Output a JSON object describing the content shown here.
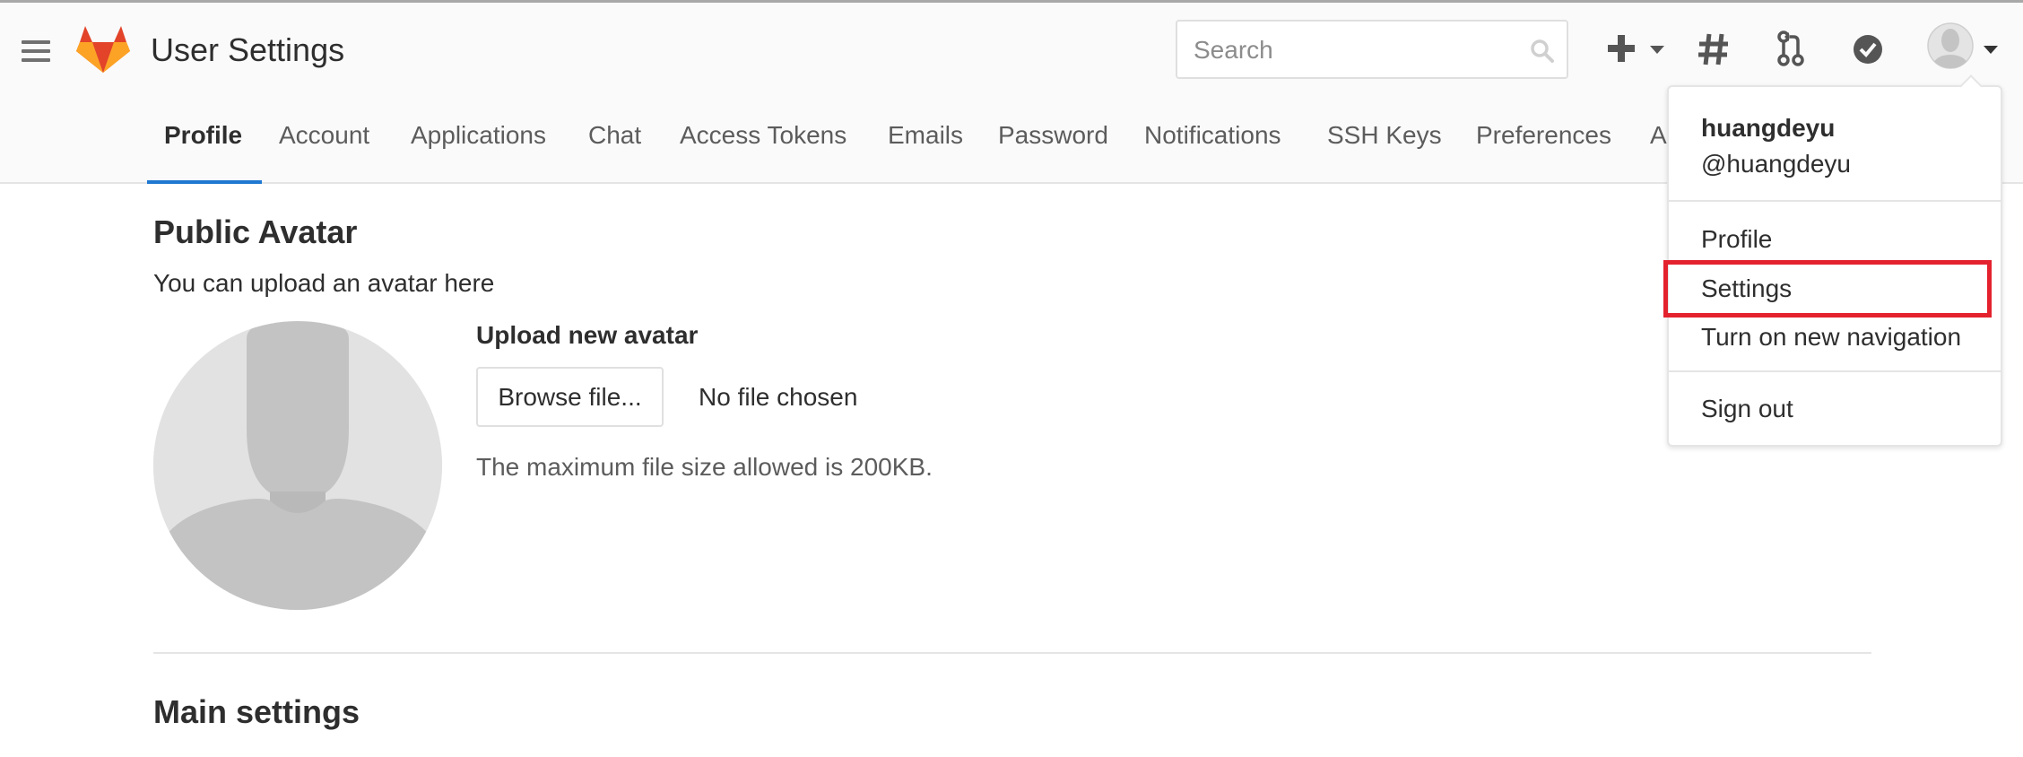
{
  "header": {
    "title": "User Settings",
    "search": {
      "placeholder": "Search",
      "value": ""
    },
    "icons": [
      "menu-icon",
      "gitlab-logo",
      "plus-icon",
      "hash-icon",
      "merge-request-icon",
      "todo-check-icon",
      "avatar",
      "caret-down-icon"
    ]
  },
  "tabs": [
    {
      "label": "Profile",
      "active": true
    },
    {
      "label": "Account"
    },
    {
      "label": "Applications"
    },
    {
      "label": "Chat"
    },
    {
      "label": "Access Tokens"
    },
    {
      "label": "Emails"
    },
    {
      "label": "Password"
    },
    {
      "label": "Notifications"
    },
    {
      "label": "SSH Keys"
    },
    {
      "label": "Preferences"
    },
    {
      "label": "A"
    }
  ],
  "avatar_section": {
    "title": "Public Avatar",
    "description": "You can upload an avatar here",
    "upload_label": "Upload new avatar",
    "browse_button": "Browse file...",
    "file_status": "No file chosen",
    "size_note": "The maximum file size allowed is 200KB."
  },
  "main_settings": {
    "title": "Main settings"
  },
  "user_menu": {
    "name": "huangdeyu",
    "handle": "@huangdeyu",
    "items": [
      "Profile",
      "Settings",
      "Turn on new navigation",
      "Sign out"
    ],
    "highlighted_item": "Settings"
  },
  "colors": {
    "accent": "#1f78d1",
    "highlight": "#e3222e",
    "header_bg": "#fafafa"
  }
}
